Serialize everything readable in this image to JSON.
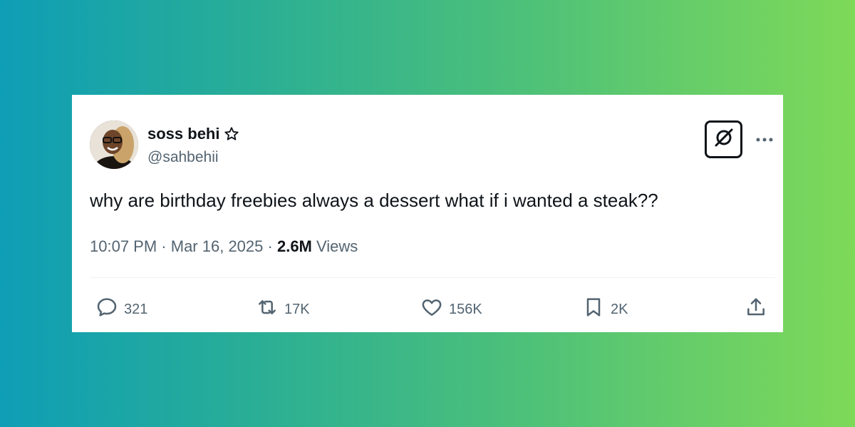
{
  "tweet": {
    "author_name": "soss behi",
    "handle": "@sahbehii",
    "text": "why are birthday freebies always a dessert what if i wanted a steak??",
    "time": "10:07 PM",
    "separator": "·",
    "date": "Mar 16, 2025",
    "views_count": "2.6M",
    "views_label": "Views"
  },
  "icons": {
    "verified": "star-outline-icon",
    "grok": "grok-icon",
    "more": "more-icon",
    "reply": "reply-icon",
    "retweet": "retweet-icon",
    "like": "heart-icon",
    "bookmark": "bookmark-icon",
    "share": "share-icon"
  },
  "actions": {
    "replies": "321",
    "reposts": "17K",
    "likes": "156K",
    "bookmarks": "2K"
  },
  "colors": {
    "text_primary": "#0f1419",
    "text_secondary": "#536471",
    "gradient_start": "#0e9eb6",
    "gradient_end": "#7ed958"
  }
}
